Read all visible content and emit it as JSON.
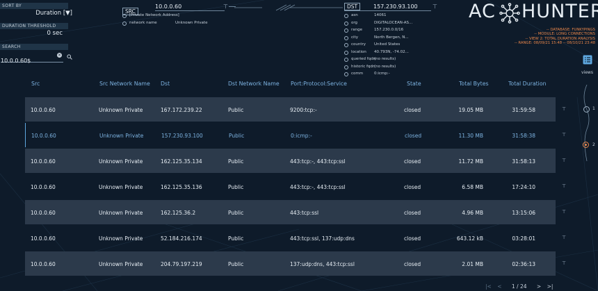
{
  "sidebar": {
    "sort_by_label": "SORT BY",
    "sort_by_value": "Duration",
    "sort_dir": "[▼]",
    "threshold_label": "DURATION THRESHOLD",
    "threshold_value": "0 sec",
    "search_label": "SEARCH",
    "search_value": "10.0.0.60$"
  },
  "src_panel": {
    "label": "SRC",
    "ip": "10.0.0.60",
    "tag": "[Private Network Address]",
    "network_name_key": "network name",
    "network_name_value": "Unknown Private"
  },
  "dst_panel": {
    "label": "DST",
    "ip": "157.230.93.100",
    "rows": [
      {
        "key": "asn",
        "value": "14061"
      },
      {
        "key": "org",
        "value": "DIGITALOCEAN-AS..."
      },
      {
        "key": "range",
        "value": "157.230.0.0/16"
      },
      {
        "key": "city",
        "value": "North Bergen, N..."
      },
      {
        "key": "country",
        "value": "United States"
      },
      {
        "key": "location",
        "value": "40.793N, -74.02..."
      },
      {
        "key": "queried fqdn",
        "value": "(no results)"
      },
      {
        "key": "historic fqdn",
        "value": "(no results)"
      },
      {
        "key": "comm",
        "value": "0:icmp:-"
      }
    ]
  },
  "brand": {
    "logo_left": "AC",
    "logo_right": "HUNTER",
    "meta": [
      "-- DATABASE: FUNKYPINGS",
      "-- MODULE: LONG CONNECTIONS",
      "-- VIEW 2: TOTAL DURATION ANALYSIS",
      "-- RANGE: 08/09/21 15:48 -- 08/10/21 23:48"
    ]
  },
  "views": {
    "label": "views",
    "items": [
      "1",
      "2"
    ]
  },
  "table": {
    "columns": [
      "Src",
      "Src Network Name",
      "Dst",
      "Dst Network Name",
      "Port:Protocol:Service",
      "State",
      "Total Bytes",
      "Total Duration"
    ],
    "rows": [
      {
        "src": "10.0.0.60",
        "src_net": "Unknown Private",
        "dst": "167.172.239.22",
        "dst_net": "Public",
        "pps": "9200:tcp:-",
        "state": "closed",
        "bytes": "19.05 MB",
        "duration": "31:59:58"
      },
      {
        "src": "10.0.0.60",
        "src_net": "Unknown Private",
        "dst": "157.230.93.100",
        "dst_net": "Public",
        "pps": "0:icmp:-",
        "state": "closed",
        "bytes": "11.30 MB",
        "duration": "31:58:38"
      },
      {
        "src": "10.0.0.60",
        "src_net": "Unknown Private",
        "dst": "162.125.35.134",
        "dst_net": "Public",
        "pps": "443:tcp:-, 443:tcp:ssl",
        "state": "closed",
        "bytes": "11.72 MB",
        "duration": "31:58:13"
      },
      {
        "src": "10.0.0.60",
        "src_net": "Unknown Private",
        "dst": "162.125.35.136",
        "dst_net": "Public",
        "pps": "443:tcp:-, 443:tcp:ssl",
        "state": "closed",
        "bytes": "6.58 MB",
        "duration": "17:24:10"
      },
      {
        "src": "10.0.0.60",
        "src_net": "Unknown Private",
        "dst": "162.125.36.2",
        "dst_net": "Public",
        "pps": "443:tcp:ssl",
        "state": "closed",
        "bytes": "4.96 MB",
        "duration": "13:15:06"
      },
      {
        "src": "10.0.0.60",
        "src_net": "Unknown Private",
        "dst": "52.184.216.174",
        "dst_net": "Public",
        "pps": "443:tcp:ssl, 137:udp:dns",
        "state": "closed",
        "bytes": "643.12 kB",
        "duration": "03:28:01"
      },
      {
        "src": "10.0.0.60",
        "src_net": "Unknown Private",
        "dst": "204.79.197.219",
        "dst_net": "Public",
        "pps": "137:udp:dns, 443:tcp:ssl",
        "state": "closed",
        "bytes": "2.01 MB",
        "duration": "02:36:13"
      }
    ]
  },
  "pager": {
    "first": "|<",
    "prev": "<",
    "text": "1 / 24",
    "next": ">",
    "last": ">|"
  },
  "colors": {
    "background": "#0e1b2a",
    "accent": "#7db3e1",
    "meta": "#e8864a",
    "row_alt": "#2c3a4b"
  }
}
